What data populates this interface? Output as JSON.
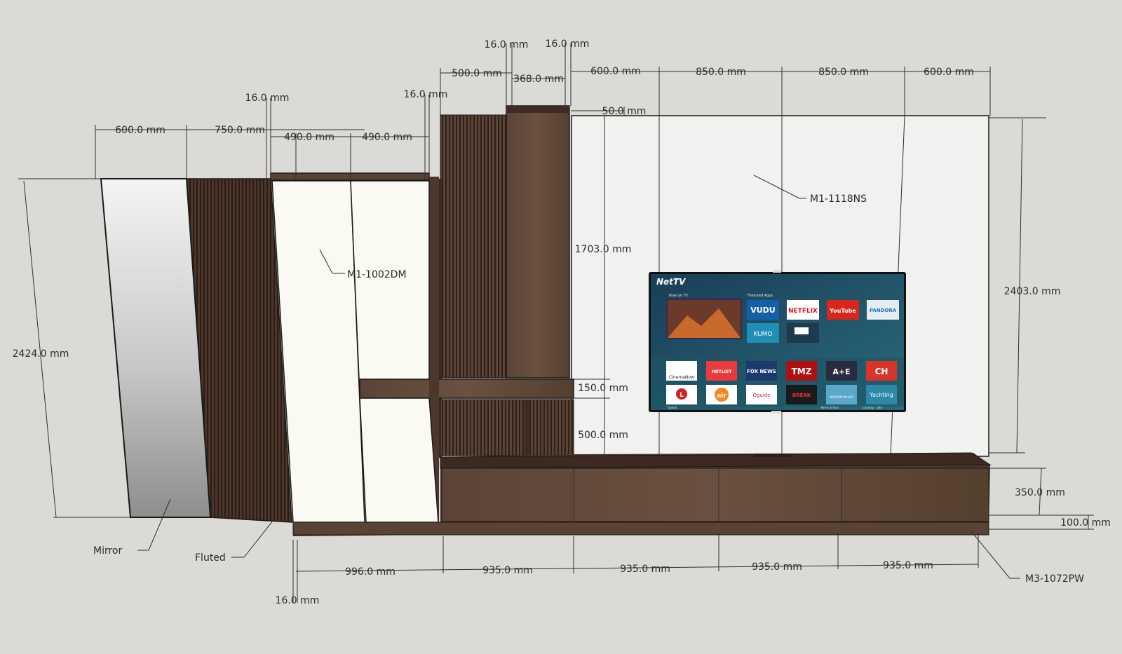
{
  "diagram": {
    "dimensions": {
      "top_600_left": "600.0 mm",
      "top_750": "750.0 mm",
      "top_490_a": "490.0 mm",
      "top_490_b": "490.0 mm",
      "top_16_a": "16.0 mm",
      "top_16_b": "16.0 mm",
      "top_500": "500.0 mm",
      "top_368": "368.0 mm",
      "top_16_c": "16.0 mm",
      "top_16_d": "16.0 mm",
      "top_600_b": "600.0 mm",
      "top_850_a": "850.0 mm",
      "top_850_b": "850.0 mm",
      "top_600_c": "600.0 mm",
      "panel_50": "50.0 mm",
      "height_1703": "1703.0 mm",
      "height_150": "150.0 mm",
      "height_500": "500.0 mm",
      "height_2403": "2403.0 mm",
      "height_2424": "2424.0 mm",
      "height_350": "350.0 mm",
      "height_100": "100.0 mm",
      "bottom_996": "996.0 mm",
      "bottom_935_a": "935.0 mm",
      "bottom_935_b": "935.0 mm",
      "bottom_935_c": "935.0 mm",
      "bottom_935_d": "935.0 mm",
      "bottom_16": "16.0 mm"
    },
    "labels": {
      "wall_panel": "M1-1118NS",
      "wardrobe": "M1-1002DM",
      "mirror": "Mirror",
      "fluted": "Fluted",
      "tv_unit": "M3-1072PW"
    },
    "tv_screen": {
      "brand": "NetTV",
      "now_on_tv": "Now on TV",
      "featured_apps": "Featured Apps",
      "apps_row1": [
        "VUDU",
        "NETFLIX",
        "YouTube",
        "PANDORA"
      ],
      "apps_row2": [
        "KUMO",
        ""
      ],
      "channels_row1": [
        "CinemaNow",
        "HOTLIST",
        "FOX NEWS",
        "TMZ",
        "A+E",
        "CH"
      ],
      "channels_row2": [
        "L",
        "air",
        "Oguide",
        "BREAK",
        "WARREN MILLER",
        "Yachting"
      ],
      "footer_left": "Option",
      "footer_mid": "Terms of Use",
      "footer_right": "Country : USA"
    },
    "colors": {
      "background": "#dcdad6",
      "wood": "#5a4335",
      "cream_door": "#fbfaf2",
      "marble": "#f1f1ef",
      "tv_bg": "#1d4a60"
    }
  }
}
